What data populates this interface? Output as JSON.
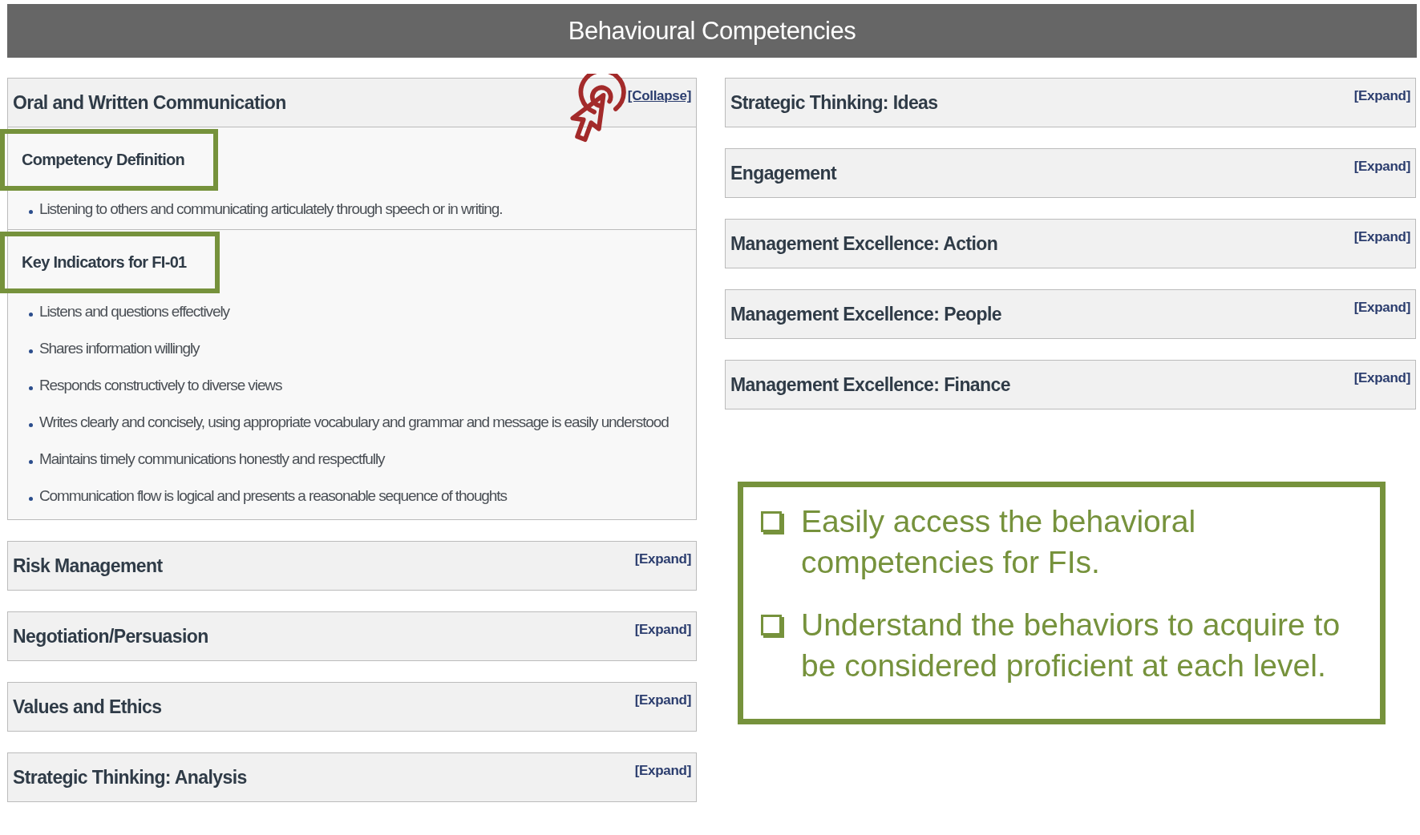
{
  "title": "Behavioural Competencies",
  "columns": [
    {
      "panels": [
        {
          "title": "Oral and Written Communication",
          "toggle": "[Collapse]",
          "expanded": true,
          "pointer": true,
          "sections": [
            {
              "heading": "Competency Definition",
              "highlighted": true,
              "items": [
                "Listening to others and communicating articulately through speech or in writing."
              ]
            },
            {
              "heading": "Key Indicators for FI-01",
              "highlighted": true,
              "items": [
                "Listens and questions effectively",
                "Shares information willingly",
                "Responds constructively to diverse views",
                "Writes clearly and concisely, using appropriate vocabulary and grammar and message is easily understood",
                "Maintains timely communications honestly and respectfully",
                "Communication flow is logical and presents a reasonable sequence of thoughts"
              ]
            }
          ]
        },
        {
          "title": "Risk Management",
          "toggle": "[Expand]",
          "expanded": false
        },
        {
          "title": "Negotiation/Persuasion",
          "toggle": "[Expand]",
          "expanded": false
        },
        {
          "title": "Values and Ethics",
          "toggle": "[Expand]",
          "expanded": false
        },
        {
          "title": "Strategic Thinking: Analysis",
          "toggle": "[Expand]",
          "expanded": false
        }
      ]
    },
    {
      "panels": [
        {
          "title": "Strategic Thinking: Ideas",
          "toggle": "[Expand]",
          "expanded": false
        },
        {
          "title": "Engagement",
          "toggle": "[Expand]",
          "expanded": false
        },
        {
          "title": "Management Excellence: Action",
          "toggle": "[Expand]",
          "expanded": false
        },
        {
          "title": "Management Excellence: People",
          "toggle": "[Expand]",
          "expanded": false
        },
        {
          "title": "Management Excellence: Finance",
          "toggle": "[Expand]",
          "expanded": false
        }
      ],
      "callout": [
        "Easily access the behavioral competencies for FIs.",
        "Understand the behaviors to acquire to be considered proficient at each level."
      ]
    }
  ]
}
